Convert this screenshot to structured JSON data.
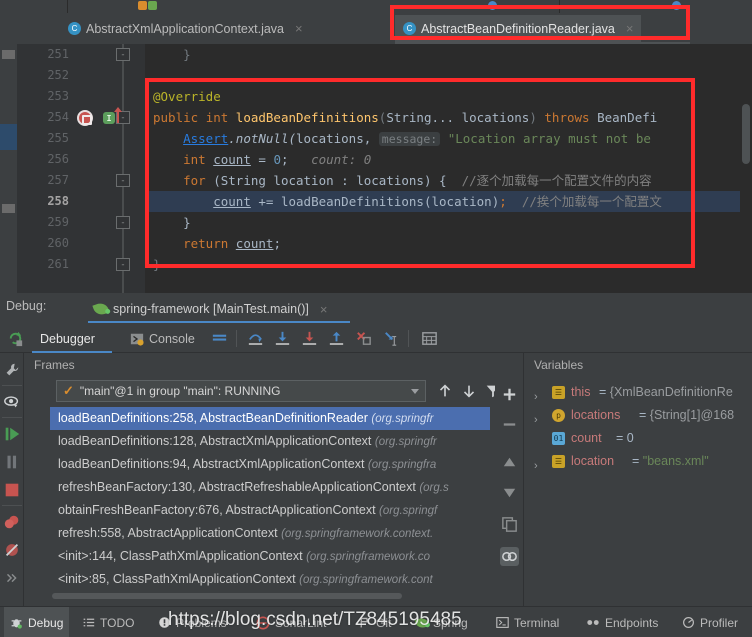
{
  "window": {
    "accent_blue": "#4a88c7",
    "annotation_red": "#ff2b2b",
    "bg": "#3c3f41",
    "editor_bg": "#2b2b2b"
  },
  "tabs": [
    {
      "label": "AbstractXmlApplicationContext.java",
      "icon": "java-class-icon",
      "badge": "C",
      "active": false,
      "close": "×"
    },
    {
      "label": "AbstractBeanDefinitionReader.java",
      "icon": "java-class-icon",
      "badge": "C",
      "active": true,
      "close": "×"
    }
  ],
  "editor": {
    "current_line": 258,
    "line_numbers": [
      251,
      252,
      253,
      254,
      255,
      256,
      257,
      258,
      259,
      260,
      261
    ],
    "lines": [
      {
        "n": 251,
        "text": "}"
      },
      {
        "n": 252,
        "text": ""
      },
      {
        "n": 253,
        "text": "@Override"
      },
      {
        "n": 254,
        "text": "public int loadBeanDefinitions(String... locations) throws BeanDefi"
      },
      {
        "n": 255,
        "text": "Assert.notNull(locations,  message: \"Location array must not be"
      },
      {
        "n": 256,
        "text": "int count = 0;   count: 0"
      },
      {
        "n": 257,
        "text": "for (String location : locations) {  //逐个加载每一个配置文件的内容"
      },
      {
        "n": 258,
        "text": "count += loadBeanDefinitions(location);  //挨个加载每一个配置文"
      },
      {
        "n": 259,
        "text": "}"
      },
      {
        "n": 260,
        "text": "return count;"
      },
      {
        "n": 261,
        "text": "}"
      }
    ],
    "tokens": {
      "override": "@Override",
      "kw_public": "public",
      "kw_int": "int",
      "method_name": "loadBeanDefinitions",
      "param_string": "String...",
      "param_locations": "locations",
      "kw_throws": "throws",
      "exception": "BeanDefi",
      "assert_class": "Assert",
      "assert_method": ".notNull(",
      "assert_arg": "locations,",
      "hint_message": "message:",
      "assert_msg": "\"Location array must not be",
      "count_decl": "count",
      "zero": "0",
      "count_hint": "count: 0",
      "kw_for": "for",
      "loop_var": "location",
      "comment_257": "//逐个加载每一个配置文件的内容",
      "comment_258": "//挨个加载每一个配置文",
      "kw_return": "return"
    },
    "gutter": {
      "breakpoint_line": 254,
      "run_marker_line": 254
    }
  },
  "debug": {
    "label": "Debug:",
    "run_config": "spring-framework [MainTest.main()]",
    "run_config_close": "×",
    "tabs": [
      {
        "label": "Debugger",
        "selected": true
      },
      {
        "label": "Console",
        "selected": false
      }
    ],
    "toolbar_icons": [
      "layout-settings-icon",
      "step-over-icon",
      "step-into-icon",
      "force-step-into-icon",
      "step-out-icon",
      "drop-frame-icon",
      "run-to-cursor-icon",
      "evaluate-expression-icon"
    ],
    "rerun_icon": "rerun-icon"
  },
  "left_rail": {
    "icons": [
      "settings-wrench-icon",
      "mute-watch-icon",
      "resume-program-icon",
      "pause-program-icon",
      "stop-icon",
      "view-breakpoints-icon",
      "mute-breakpoints-icon",
      "more-icon"
    ]
  },
  "frames": {
    "title": "Frames",
    "thread": "\"main\"@1 in group \"main\": RUNNING",
    "thread_check": "✓",
    "nav_icons": [
      "move-up-icon",
      "move-down-icon",
      "filter-icon"
    ],
    "items": [
      {
        "method": "loadBeanDefinitions:258, AbstractBeanDefinitionReader",
        "pkg": "(org.springfr",
        "selected": true
      },
      {
        "method": "loadBeanDefinitions:128, AbstractXmlApplicationContext",
        "pkg": "(org.springfr",
        "selected": false
      },
      {
        "method": "loadBeanDefinitions:94, AbstractXmlApplicationContext",
        "pkg": "(org.springfra",
        "selected": false
      },
      {
        "method": "refreshBeanFactory:130, AbstractRefreshableApplicationContext",
        "pkg": "(org.s",
        "selected": false
      },
      {
        "method": "obtainFreshBeanFactory:676, AbstractApplicationContext",
        "pkg": "(org.springf",
        "selected": false
      },
      {
        "method": "refresh:558, AbstractApplicationContext",
        "pkg": "(org.springframework.context.",
        "selected": false
      },
      {
        "method": "<init>:144, ClassPathXmlApplicationContext",
        "pkg": "(org.springframework.co",
        "selected": false
      },
      {
        "method": "<init>:85, ClassPathXmlApplicationContext",
        "pkg": "(org.springframework.cont",
        "selected": false
      }
    ]
  },
  "variables": {
    "title": "Variables",
    "rail_icons": [
      "add-watch-icon",
      "remove-watch-icon",
      "move-up-icon",
      "move-down-icon",
      "copy-icon",
      "watches-icon"
    ],
    "rows": [
      {
        "expander": "›",
        "kind": "obj",
        "badge": "☰",
        "name": "this",
        "eq": " = ",
        "value": "{XmlBeanDefinitionRe",
        "value_kind": "obj"
      },
      {
        "expander": "›",
        "kind": "par",
        "badge": "p",
        "name": "locations",
        "eq": " = ",
        "value": "{String[1]@168",
        "value_kind": "obj"
      },
      {
        "expander": "",
        "kind": "prim",
        "badge": "01",
        "name": "count",
        "eq": " = ",
        "value": "0",
        "value_kind": "num"
      },
      {
        "expander": "›",
        "kind": "obj",
        "badge": "☰",
        "name": "location",
        "eq": " = ",
        "value": "\"beans.xml\"",
        "value_kind": "str"
      }
    ]
  },
  "status_bar": {
    "items": [
      {
        "label": "Debug",
        "icon": "debug-bug-icon",
        "selected": true
      },
      {
        "label": "TODO",
        "icon": "todo-list-icon",
        "selected": false
      },
      {
        "label": "Problems",
        "icon": "problems-icon",
        "selected": false
      },
      {
        "label": "SonarLint",
        "icon": "sonarlint-icon",
        "selected": false
      },
      {
        "label": "Git",
        "icon": "git-branch-icon",
        "selected": false
      },
      {
        "label": "Spring",
        "icon": "spring-leaf-icon",
        "selected": false
      },
      {
        "label": "Terminal",
        "icon": "terminal-icon",
        "selected": false
      },
      {
        "label": "Endpoints",
        "icon": "endpoints-icon",
        "selected": false
      },
      {
        "label": "Profiler",
        "icon": "profiler-icon",
        "selected": false
      }
    ]
  },
  "watermark": {
    "text": "https://blog.csdn.net/TZ845195485"
  }
}
